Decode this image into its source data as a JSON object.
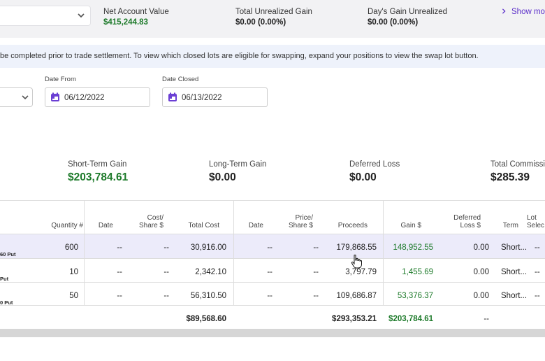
{
  "header": {
    "metrics": [
      {
        "label": "Net Account Value",
        "value": "$415,244.83",
        "color": "#1d7a2a"
      },
      {
        "label": "Total Unrealized Gain",
        "value": "$0.00  (0.00%)"
      },
      {
        "label": "Day's Gain Unrealized",
        "value": "$0.00  (0.00%)"
      }
    ],
    "show_more": "Show mo"
  },
  "banner": {
    "text": "be completed prior to trade settlement. To view which closed lots are eligible for swapping, expand your positions to view the swap lot button."
  },
  "filters": {
    "date_from_label": "Date From",
    "date_from_value": "06/12/2022",
    "date_closed_label": "Date Closed",
    "date_closed_value": "06/13/2022"
  },
  "summary": [
    {
      "label": "Short-Term Gain",
      "value": "$203,784.61",
      "color": "#1d7a2a"
    },
    {
      "label": "Long-Term Gain",
      "value": "$0.00"
    },
    {
      "label": "Deferred Loss",
      "value": "$0.00"
    },
    {
      "label": "Total Commissi",
      "value": "$285.39"
    }
  ],
  "table": {
    "headers": {
      "quantity": "Quantity #",
      "open_date": "Date",
      "cost_share_1": "Cost/",
      "cost_share_2": "Share $",
      "total_cost": "Total Cost",
      "close_date": "Date",
      "price_share_1": "Price/",
      "price_share_2": "Share $",
      "proceeds": "Proceeds",
      "gain": "Gain $",
      "deferred_1": "Deferred",
      "deferred_2": "Loss $",
      "term": "Term",
      "lot_1": "Lot",
      "lot_2": "Selec"
    },
    "rows": [
      {
        "symbol": "60 Put",
        "quantity": "600",
        "open_date": "--",
        "cost_share": "--",
        "total_cost": "30,916.00",
        "close_date": "--",
        "price_share": "--",
        "proceeds": "179,868.55",
        "gain": "148,952.55",
        "deferred": "0.00",
        "term": "Short...",
        "lot": "--"
      },
      {
        "symbol": "Put",
        "quantity": "10",
        "open_date": "--",
        "cost_share": "--",
        "total_cost": "2,342.10",
        "close_date": "--",
        "price_share": "--",
        "proceeds": "3,797.79",
        "gain": "1,455.69",
        "deferred": "0.00",
        "term": "Short...",
        "lot": "--"
      },
      {
        "symbol": "0 Put",
        "quantity": "50",
        "open_date": "--",
        "cost_share": "--",
        "total_cost": "56,310.50",
        "close_date": "--",
        "price_share": "--",
        "proceeds": "109,686.87",
        "gain": "53,376.37",
        "deferred": "0.00",
        "term": "Short...",
        "lot": "--"
      }
    ],
    "totals": {
      "total_cost": "$89,568.60",
      "proceeds": "$293,353.21",
      "gain": "$203,784.61",
      "deferred": "--"
    }
  },
  "colors": {
    "accent": "#5b2fc9",
    "positive": "#1d7a2a",
    "highlight_row": "#ecebfa"
  },
  "icons": [
    "chevron-down-icon",
    "chevron-right-icon",
    "calendar-icon",
    "hand-cursor-icon"
  ]
}
